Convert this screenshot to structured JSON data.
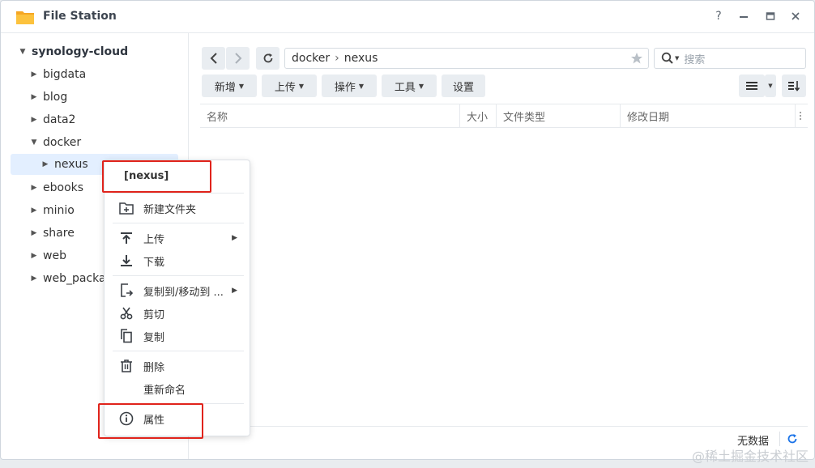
{
  "window": {
    "title": "File Station"
  },
  "titlebar_buttons": {
    "help": "?"
  },
  "sidebar": {
    "root": "synology-cloud",
    "items": [
      "bigdata",
      "blog",
      "data2",
      "docker",
      "nexus",
      "ebooks",
      "minio",
      "share",
      "web",
      "web_packag"
    ]
  },
  "nav": {
    "path": [
      "docker",
      "nexus"
    ],
    "separator": "›"
  },
  "search": {
    "placeholder": "搜索"
  },
  "toolbar": {
    "create": "新增",
    "upload": "上传",
    "action": "操作",
    "tools": "工具",
    "settings": "设置"
  },
  "columns": {
    "name": "名称",
    "size": "大小",
    "type": "文件类型",
    "modified": "修改日期"
  },
  "status": {
    "text": "无数据"
  },
  "context_menu": {
    "title": "[nexus]",
    "new_folder": "新建文件夹",
    "upload": "上传",
    "download": "下载",
    "copy_move": "复制到/移动到 ...",
    "cut": "剪切",
    "copy": "复制",
    "delete": "删除",
    "rename": "重新命名",
    "properties": "属性"
  },
  "watermark": "@稀土掘金技术社区",
  "colors": {
    "highlight_box": "#e0231b",
    "selected_bg": "#e3efff",
    "accent": "#1a73e8"
  }
}
